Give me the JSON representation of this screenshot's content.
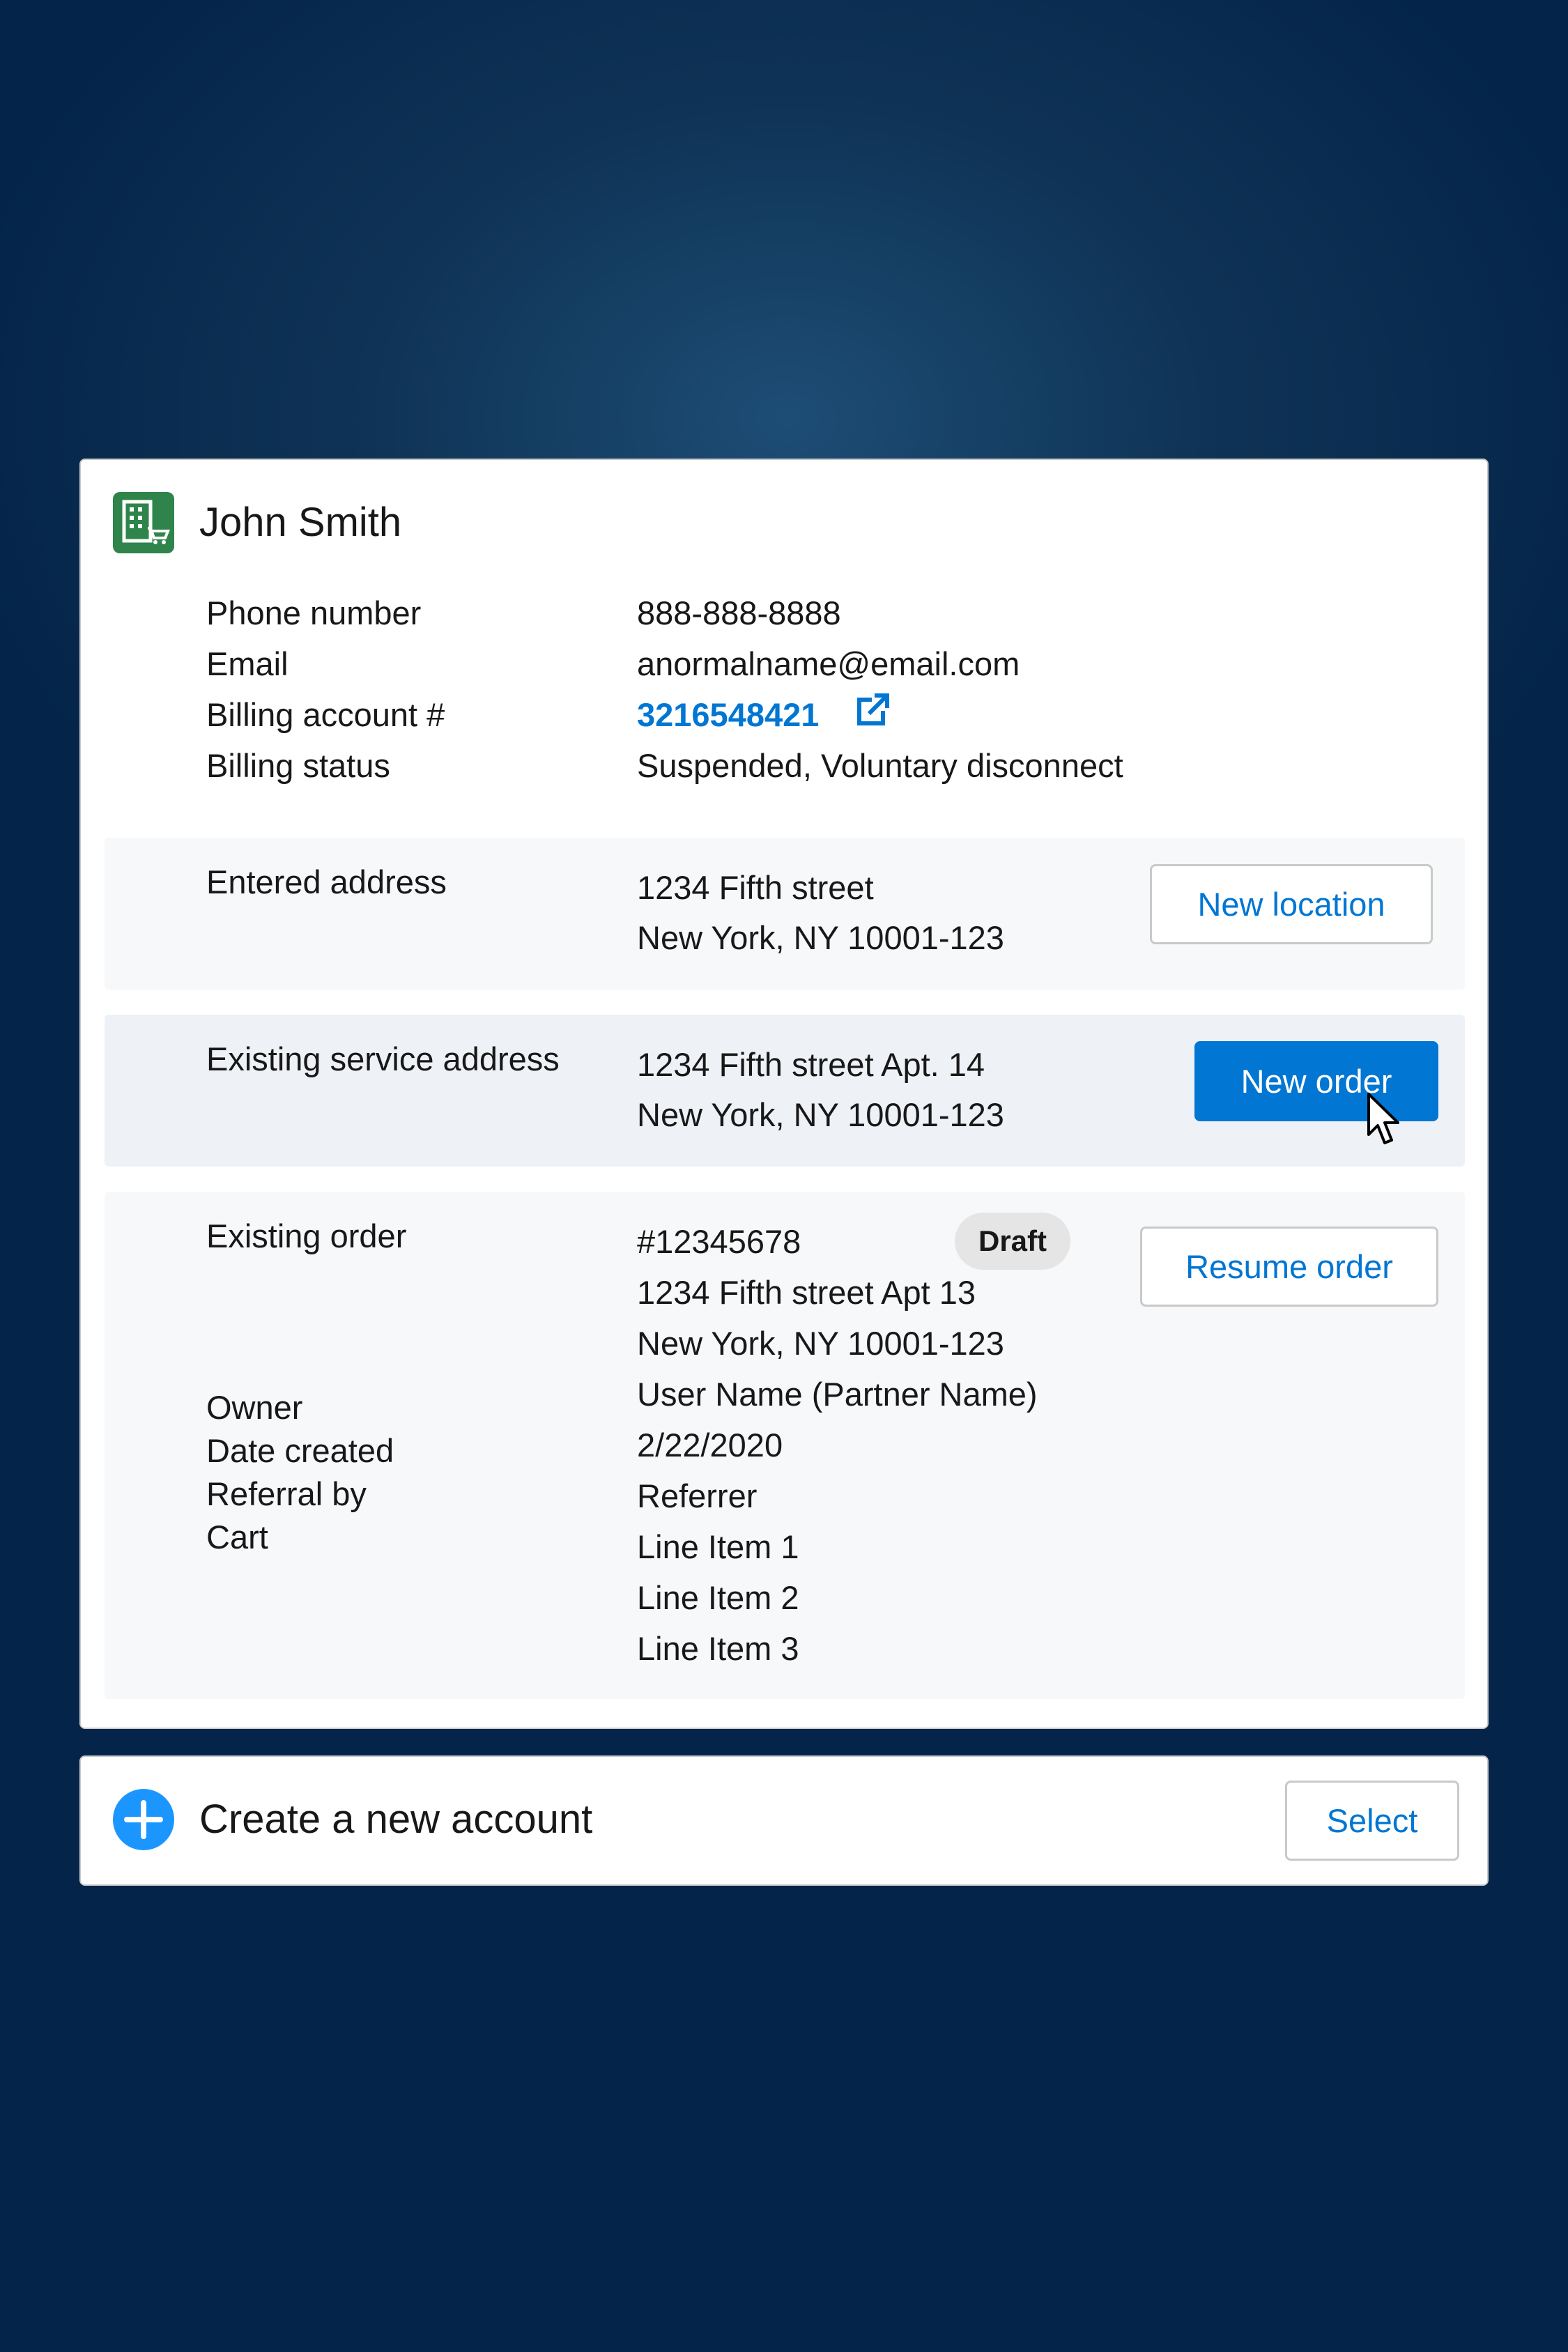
{
  "account": {
    "name": "John Smith",
    "icon": "building-cart-icon",
    "fields": [
      {
        "label": "Phone number",
        "value": "888-888-8888"
      },
      {
        "label": "Email",
        "value": "anormalname@email.com"
      },
      {
        "label": "Billing account #",
        "value": "3216548421"
      },
      {
        "label": "Billing status",
        "value": "Suspended, Voluntary disconnect"
      }
    ]
  },
  "entered_address": {
    "label": "Entered address",
    "line1": "1234 Fifth street",
    "line2": "New York, NY 10001-123",
    "button": "New location"
  },
  "service_address": {
    "label": "Existing service address",
    "line1": "1234 Fifth street Apt. 14",
    "line2": "New York, NY 10001-123",
    "button": "New order"
  },
  "existing_order": {
    "label": "Existing order",
    "number": "#12345678",
    "status": "Draft",
    "line1": "1234 Fifth street Apt 13",
    "line2": "New York, NY 10001-123",
    "owner_label": "Owner",
    "owner": "User Name (Partner Name)",
    "date_label": "Date created",
    "date": "2/22/2020",
    "referral_label": "Referral by",
    "referral": "Referrer",
    "cart_label": "Cart",
    "cart_items": [
      "Line Item 1",
      "Line Item 2",
      "Line Item 3"
    ],
    "button": "Resume order"
  },
  "create_account": {
    "title": "Create a new account",
    "button": "Select",
    "icon": "plus-icon"
  },
  "colors": {
    "brand_blue": "#0176d3",
    "icon_green": "#2e844a",
    "plus_blue": "#1b96ff"
  }
}
